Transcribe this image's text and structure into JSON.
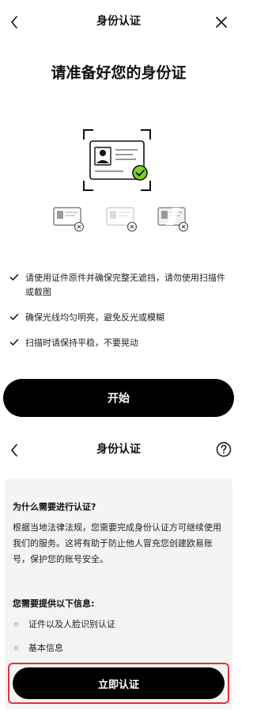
{
  "screen1": {
    "title": "身份认证",
    "back_icon": "chevron-left-icon",
    "close_icon": "close-icon",
    "headline": "请准备好您的身份证",
    "tips": [
      "请使用证件原件并确保完整无遮挡，请勿使用扫描件或截图",
      "确保光线均匀明亮，避免反光或模糊",
      "扫描时请保持平稳，不要晃动"
    ],
    "start_button": "开始",
    "accent_color": "#7ed321"
  },
  "screen2": {
    "title": "身份认证",
    "back_icon": "chevron-left-icon",
    "help_icon": "question-circle-icon",
    "why_title": "为什么需要进行认证?",
    "why_text": "根据当地法律法规，您需要完成身份认证方可继续使用我们的服务。这将有助于防止他人冒充您创建欧易账号，保护您的账号安全。",
    "requirements_title": "您需要提供以下信息:",
    "requirements": [
      "证件以及人脸识别认证",
      "基本信息"
    ],
    "verify_button": "立即认证",
    "highlight_color": "#e2323a"
  }
}
